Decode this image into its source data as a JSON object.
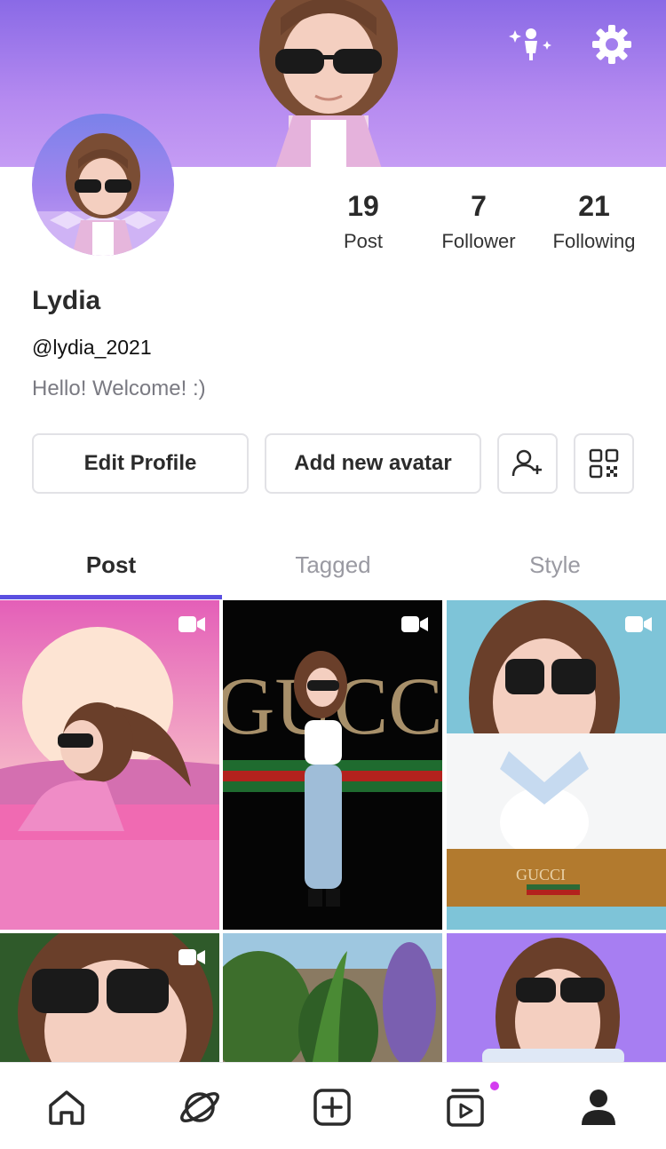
{
  "profile": {
    "name": "Lydia",
    "handle": "@lydia_2021",
    "bio": "Hello! Welcome! :)"
  },
  "stats": [
    {
      "value": "19",
      "label": "Post"
    },
    {
      "value": "7",
      "label": "Follower"
    },
    {
      "value": "21",
      "label": "Following"
    }
  ],
  "actions": {
    "edit_profile": "Edit Profile",
    "add_avatar": "Add new avatar",
    "add_friend_icon": "person-add-icon",
    "qr_icon": "qr-code-icon"
  },
  "header_icons": [
    "sparkle-avatar-icon",
    "gear-icon"
  ],
  "tabs": [
    {
      "label": "Post",
      "active": true
    },
    {
      "label": "Tagged",
      "active": false
    },
    {
      "label": "Style",
      "active": false
    }
  ],
  "posts": [
    {
      "scene": "sunset-convertible",
      "type": "video"
    },
    {
      "scene": "gucci-dance",
      "type": "video",
      "text": "GUCCI"
    },
    {
      "scene": "gucci-table",
      "type": "video",
      "text": "GUCCI"
    },
    {
      "scene": "forest-closeup",
      "type": "video"
    },
    {
      "scene": "garden-plants",
      "type": "photo"
    },
    {
      "scene": "purple-portrait",
      "type": "photo"
    }
  ],
  "bottom_nav": [
    {
      "icon": "home-icon"
    },
    {
      "icon": "planet-icon"
    },
    {
      "icon": "plus-square-icon"
    },
    {
      "icon": "video-feed-icon",
      "notification_dot": true
    },
    {
      "icon": "profile-icon",
      "active": true
    }
  ],
  "colors": {
    "accent": "#5a4fe0",
    "cover_top": "#8a6ae6",
    "cover_bottom": "#c59cf4",
    "notification": "#d43cf0"
  }
}
